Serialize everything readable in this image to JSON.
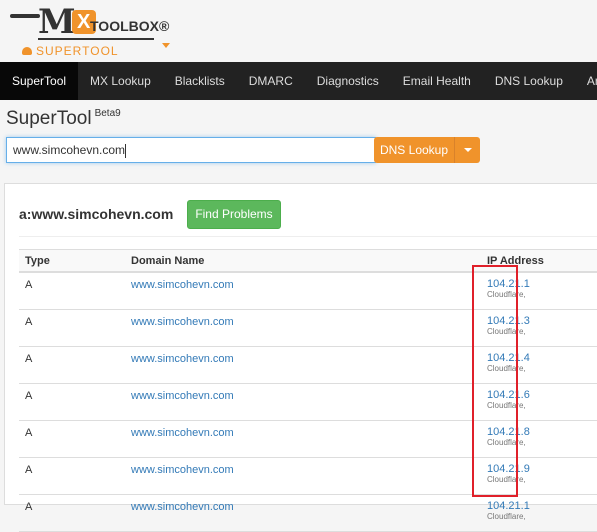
{
  "logo": {
    "brand_m": "M",
    "brand_x": "X",
    "brand_toolbox": "TOOLBOX®",
    "brand_supertool": "SUPERTOOL"
  },
  "nav": {
    "items": [
      "SuperTool",
      "MX Lookup",
      "Blacklists",
      "DMARC",
      "Diagnostics",
      "Email Health",
      "DNS Lookup",
      "Analyze"
    ]
  },
  "page": {
    "title": "SuperTool",
    "version": "Beta9"
  },
  "search": {
    "value": "www.simcohevn.com",
    "button_label": "DNS Lookup"
  },
  "results": {
    "title": "a:www.simcohevn.com",
    "find_problems_label": "Find Problems",
    "columns": [
      "Type",
      "Domain Name",
      "IP Address"
    ],
    "rows": [
      {
        "type": "A",
        "domain": "www.simcohevn.com",
        "ip": "104.21.1",
        "provider": "Cloudflare,"
      },
      {
        "type": "A",
        "domain": "www.simcohevn.com",
        "ip": "104.21.3",
        "provider": "Cloudflare,"
      },
      {
        "type": "A",
        "domain": "www.simcohevn.com",
        "ip": "104.21.4",
        "provider": "Cloudflare,"
      },
      {
        "type": "A",
        "domain": "www.simcohevn.com",
        "ip": "104.21.6",
        "provider": "Cloudflare,"
      },
      {
        "type": "A",
        "domain": "www.simcohevn.com",
        "ip": "104.21.8",
        "provider": "Cloudflare,"
      },
      {
        "type": "A",
        "domain": "www.simcohevn.com",
        "ip": "104.21.9",
        "provider": "Cloudflare,"
      },
      {
        "type": "A",
        "domain": "www.simcohevn.com",
        "ip": "104.21.1",
        "provider": "Cloudflare,"
      }
    ]
  },
  "colors": {
    "accent_orange": "#f0932b",
    "nav_bg": "#222222",
    "link_blue": "#337ab7",
    "success_green": "#5cb85c",
    "highlight_red": "#e0202a"
  }
}
